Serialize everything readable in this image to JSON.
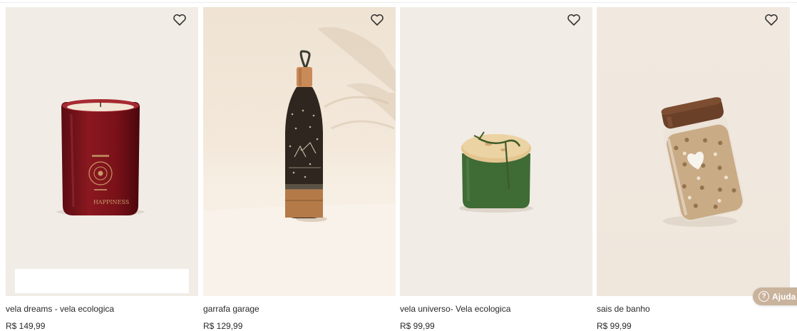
{
  "products": [
    {
      "name": "vela dreams - vela ecologica",
      "price": "R$ 149,99",
      "jar_label": "HAPPINESS"
    },
    {
      "name": "garrafa garage",
      "price": "R$ 129,99"
    },
    {
      "name": "vela universo- Vela ecologica",
      "price": "R$ 99,99"
    },
    {
      "name": "sais de banho",
      "price": "R$ 99,99"
    }
  ],
  "favorite_icon": "heart-outline-icon",
  "help_button": {
    "label": "Ajuda",
    "icon": "question-circle-icon",
    "color": "#c9b39c"
  }
}
